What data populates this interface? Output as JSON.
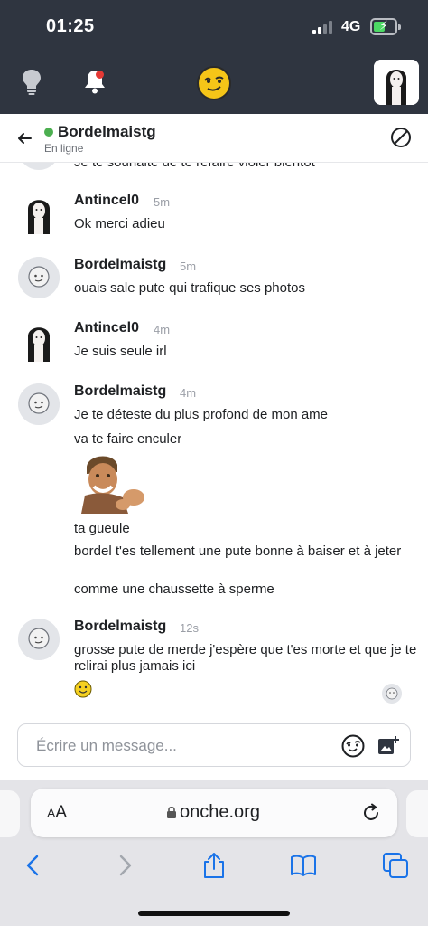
{
  "status_bar": {
    "time": "01:25",
    "network": "4G"
  },
  "conversation": {
    "name": "Bordelmaistg",
    "status": "En ligne"
  },
  "partial_message": "Je te souhaite de te refaire violer bientôt",
  "messages": [
    {
      "author": "Antincel0",
      "time": "5m",
      "lines": [
        "Ok merci adieu"
      ]
    },
    {
      "author": "Bordelmaistg",
      "time": "5m",
      "lines": [
        "ouais sale pute qui trafique ses photos"
      ]
    },
    {
      "author": "Antincel0",
      "time": "4m",
      "lines": [
        "Je suis seule irl"
      ]
    },
    {
      "author": "Bordelmaistg",
      "time": "4m",
      "lines": [
        "Je te déteste du plus profond de mon ame",
        "va te faire enculer",
        "ta gueule",
        "bordel t'es tellement une pute bonne à baiser et à jeter",
        "comme une chaussette à sperme"
      ]
    },
    {
      "author": "Bordelmaistg",
      "time": "12s",
      "lines": [
        "grosse pute de merde j'espère que t'es morte et que je te relirai plus jamais ici"
      ]
    }
  ],
  "compose": {
    "placeholder": "Écrire un message..."
  },
  "browser": {
    "text_size_label": "AA",
    "url": "onche.org"
  },
  "colors": {
    "header_bg": "#2f3540",
    "online": "#4caf50",
    "notification": "#e53935",
    "logo_yellow": "#f5c518",
    "browser_blue": "#1a73e8"
  },
  "icons": {
    "header": [
      "lightbulb-icon",
      "bell-icon",
      "logo-smiley-icon",
      "profile-avatar"
    ],
    "conversation": [
      "back-arrow-icon",
      "block-icon"
    ],
    "compose": [
      "emoji-icon",
      "add-image-icon"
    ],
    "browser": [
      "lock-icon",
      "reload-icon",
      "back-icon",
      "forward-icon",
      "share-icon",
      "bookmarks-icon",
      "tabs-icon"
    ]
  }
}
